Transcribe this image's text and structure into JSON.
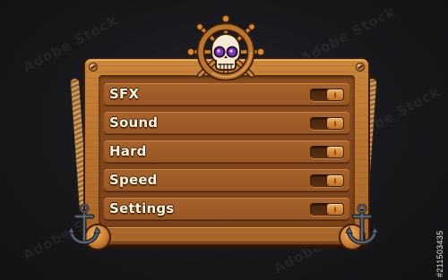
{
  "settings": {
    "rows": [
      {
        "label": "SFX",
        "toggle_on": true
      },
      {
        "label": "Sound",
        "toggle_on": true
      },
      {
        "label": "Hard",
        "toggle_on": true
      },
      {
        "label": "Speed",
        "toggle_on": true
      },
      {
        "label": "Settings",
        "toggle_on": true
      }
    ]
  },
  "decor": {
    "header_icon": "skull-ship-wheel-icon",
    "corner_icons": [
      "anchor-icon",
      "anchor-icon"
    ],
    "side_decor": "rope"
  },
  "watermark": {
    "text": "Adobe Stock",
    "id": "#211503435"
  },
  "colors": {
    "background": "#17171a",
    "wood_light": "#c9853b",
    "wood_dark": "#7a4119",
    "row": "#a9622a",
    "label_text": "#fff6df",
    "skull_eye": "#7b3bb5"
  }
}
